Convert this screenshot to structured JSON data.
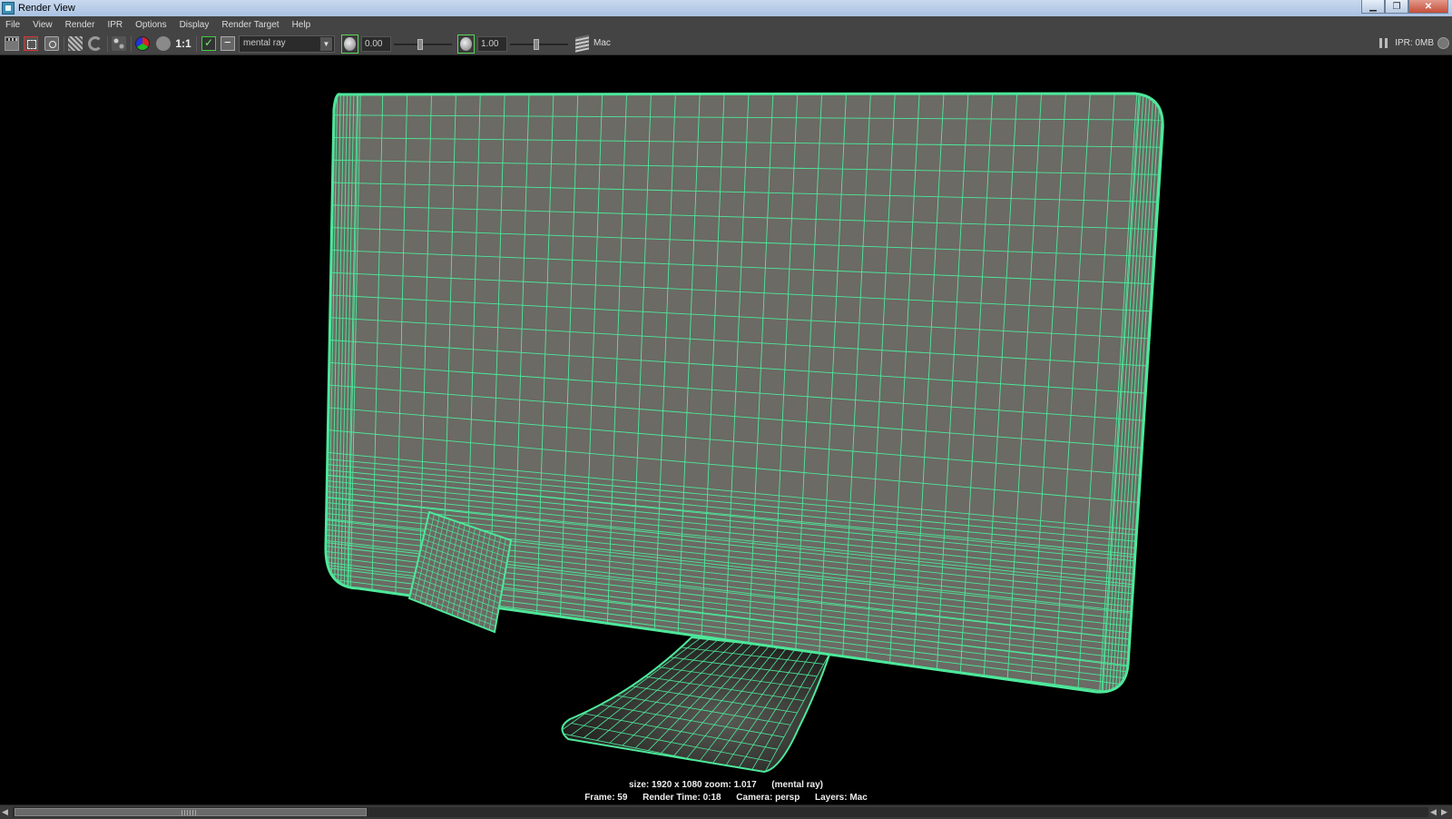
{
  "window": {
    "title": "Render View",
    "controls": {
      "minimize": "▁",
      "maximize": "❐",
      "close": "✕"
    }
  },
  "menubar": {
    "items": [
      "File",
      "View",
      "Render",
      "IPR",
      "Options",
      "Display",
      "Render Target",
      "Help"
    ]
  },
  "toolbar": {
    "one_to_one_label": "1:1",
    "renderer": "mental ray",
    "exposure": "0.00",
    "exposure_slider_fraction": 0.45,
    "gamma": "1.00",
    "gamma_slider_fraction": 0.45,
    "render_layer": "Mac",
    "ipr_memory": "IPR: 0MB",
    "icons": [
      "clapper-icon",
      "render-region-icon",
      "snapshot-icon",
      "ipr-render-icon",
      "refresh-icon",
      "redo-previous-icon",
      "rgb-channels-icon",
      "alpha-channel-icon",
      "keep-image-icon",
      "remove-image-icon",
      "exposure-icon",
      "gamma-icon",
      "render-layer-icon",
      "pause-icon",
      "status-light-icon"
    ]
  },
  "viewport": {
    "status_line1": "size: 1920 x 1080 zoom: 1.017      (mental ray)",
    "status_line2": "Frame: 59      Render Time: 0:18      Camera: persp      Layers: Mac",
    "wireframe_color": "#4de89a",
    "surface_color": "#6b6a64"
  },
  "scrollbar": {
    "left_arrow": "◀",
    "right_arrow": "◀",
    "right_arrow2": "▶"
  }
}
